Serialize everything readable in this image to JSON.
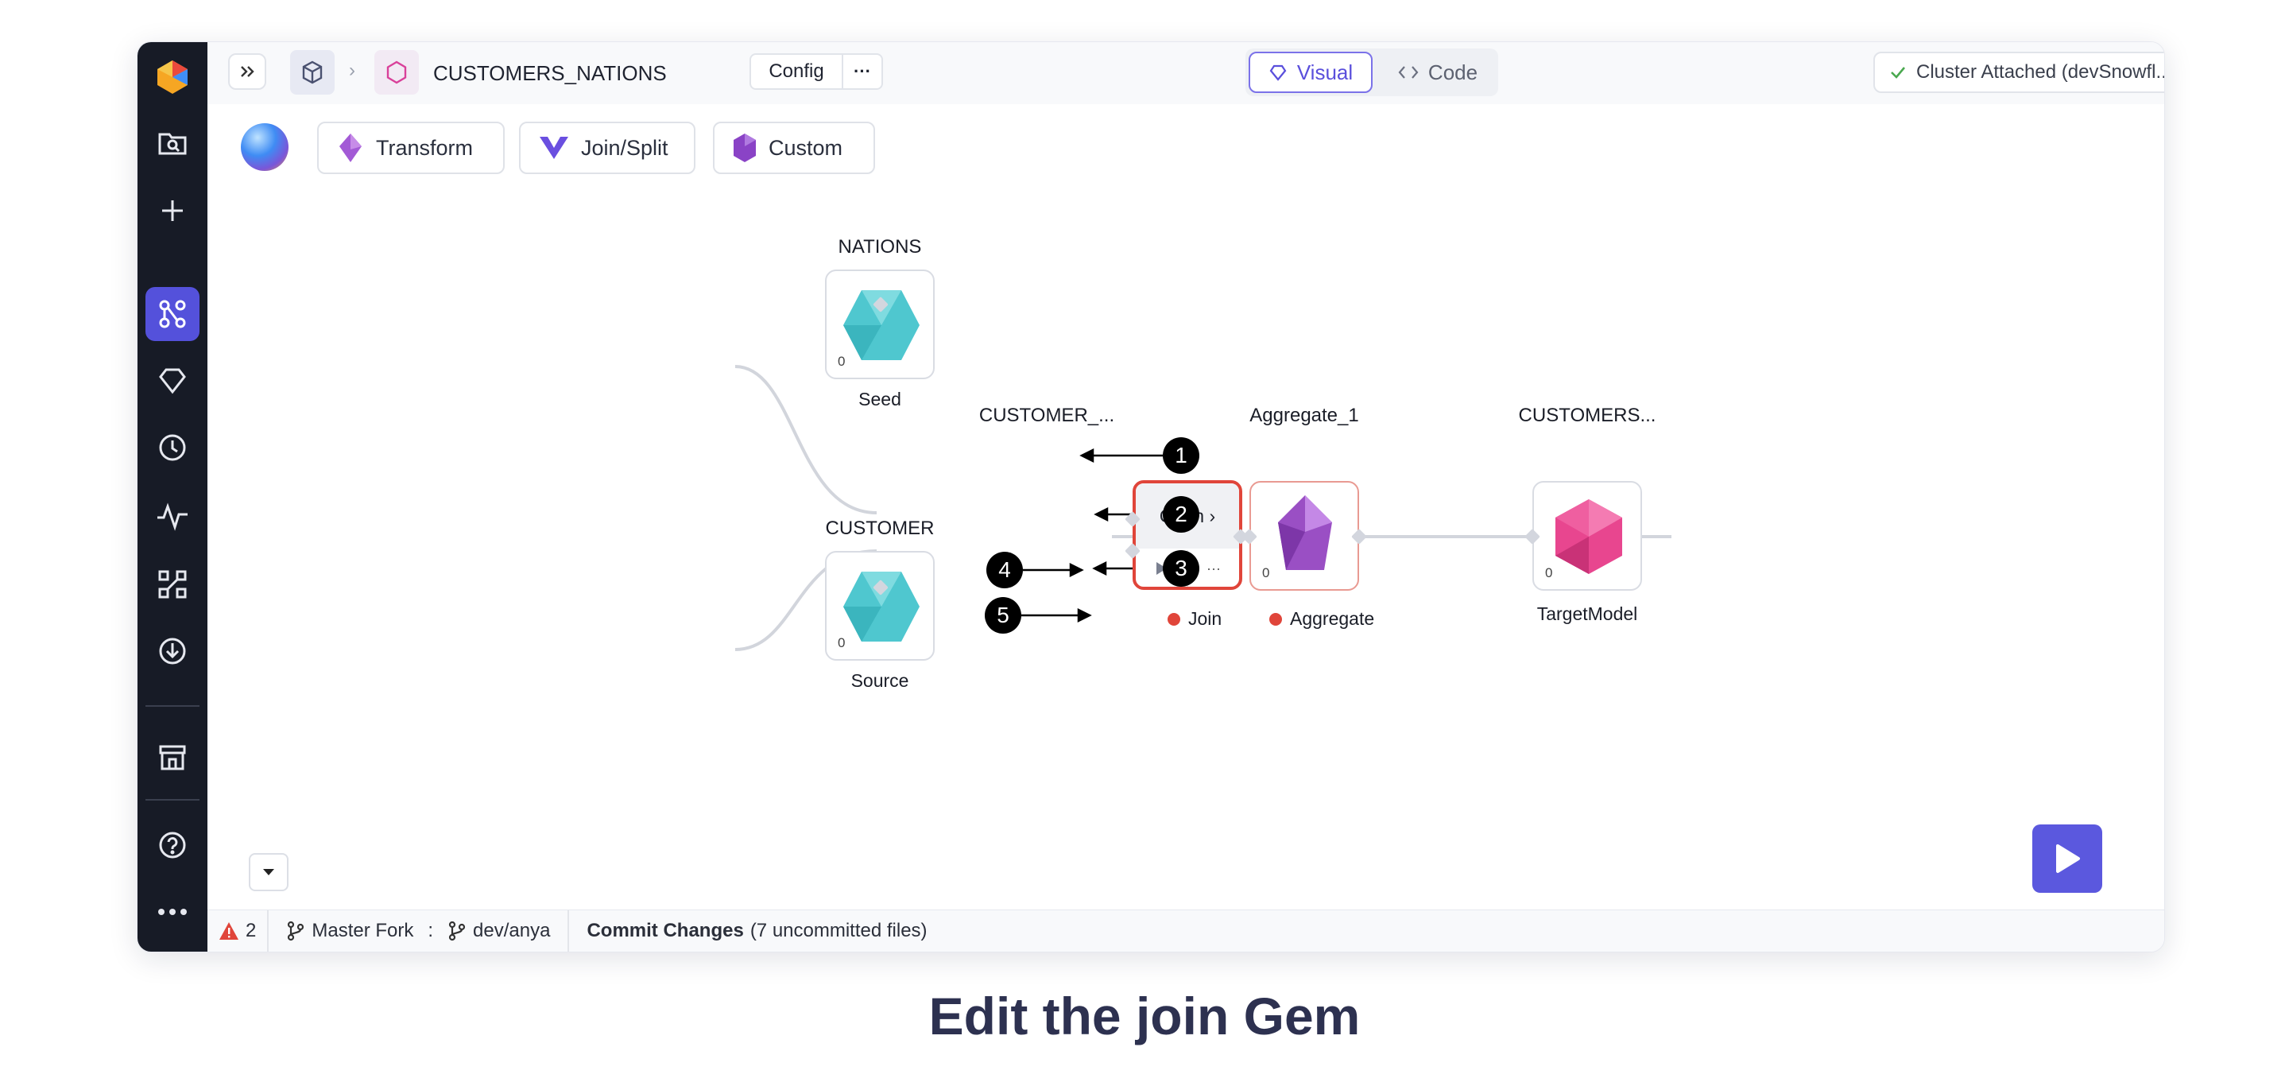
{
  "topbar": {
    "project_name": "CUSTOMERS_NATIONS",
    "config_label": "Config",
    "more_label": "···",
    "visual_label": "Visual",
    "code_label": "Code",
    "cluster_label": "Cluster Attached (devSnowfl..."
  },
  "toolbar": {
    "transform_label": "Transform",
    "joinsplit_label": "Join/Split",
    "custom_label": "Custom"
  },
  "nodes": {
    "nations": {
      "title": "NATIONS",
      "subtitle": "Seed",
      "count": "0"
    },
    "customer": {
      "title": "CUSTOMER",
      "subtitle": "Source",
      "count": "0"
    },
    "join": {
      "title": "CUSTOMER_...",
      "subtitle": "Join",
      "open_label": "Open ›",
      "more_label": "···"
    },
    "aggregate": {
      "title": "Aggregate_1",
      "subtitle": "Aggregate",
      "count": "0"
    },
    "target": {
      "title": "CUSTOMERS...",
      "subtitle": "TargetModel",
      "count": "0"
    }
  },
  "callouts": [
    "1",
    "2",
    "3",
    "4",
    "5"
  ],
  "statusbar": {
    "error_count": "2",
    "master_fork": "Master Fork",
    "separator": ":",
    "branch": "dev/anya",
    "commit_label": "Commit Changes",
    "commit_detail": "(7 uncommitted files)"
  },
  "caption": "Edit the join Gem",
  "colors": {
    "accent": "#5451db",
    "sidebar_bg": "#171b26",
    "error_red": "#e0453a",
    "seed_teal": "#4fc7cf",
    "aggregate_purple": "#9a4fc4",
    "target_pink": "#e8468f"
  },
  "icons": [
    "logo-icon",
    "search-folder-icon",
    "plus-icon",
    "pipeline-icon",
    "gem-icon",
    "clock-icon",
    "activity-icon",
    "graph-icon",
    "download-icon",
    "store-icon",
    "help-icon",
    "more-icon",
    "expand-icon",
    "cube-icon",
    "hexagon-icon",
    "check-icon",
    "chevron-down-icon",
    "play-icon"
  ]
}
